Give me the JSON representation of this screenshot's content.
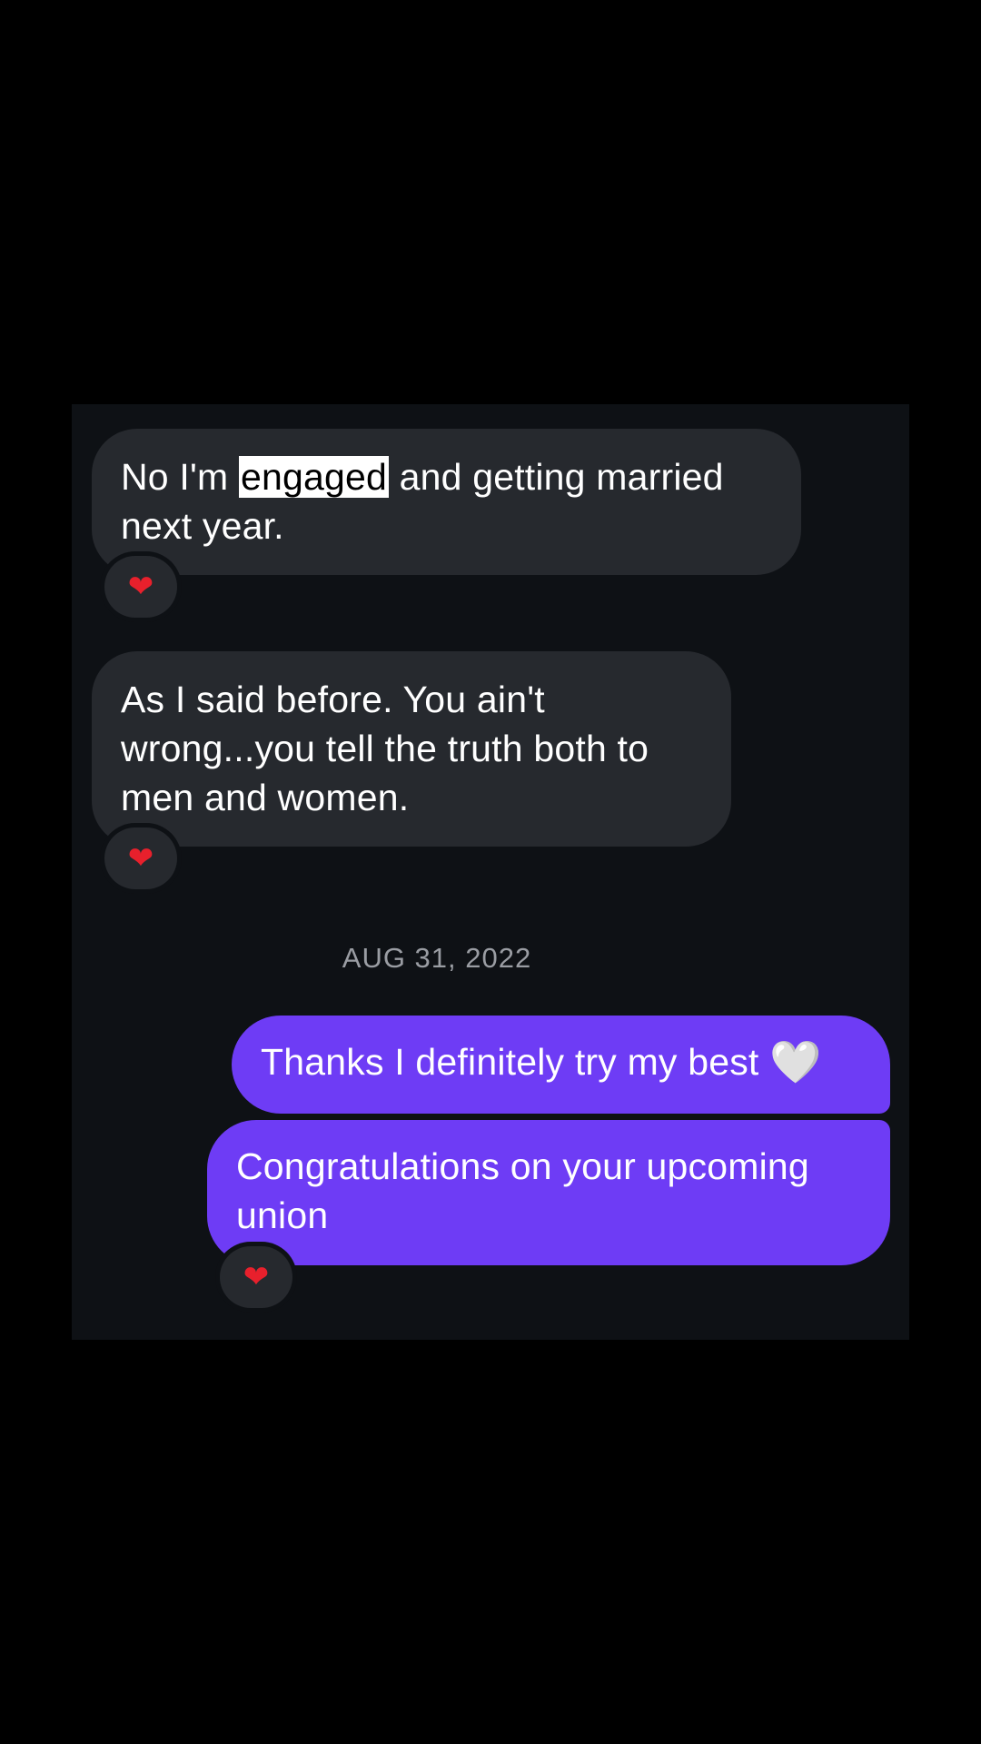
{
  "conversation": {
    "messages": [
      {
        "direction": "incoming",
        "text_before": "No I'm ",
        "highlighted": "engaged",
        "text_after": " and getting married next year.",
        "reaction": "❤"
      },
      {
        "direction": "incoming",
        "text": "As I said before. You ain't wrong...you tell the truth both to men and women.",
        "reaction": "❤"
      },
      {
        "direction": "outgoing",
        "text": "Thanks I definitely try my best",
        "emoji": "🤍"
      },
      {
        "direction": "outgoing",
        "text": "Congratulations on your upcoming union",
        "reaction": "❤"
      }
    ],
    "date_separator": "AUG 31, 2022"
  },
  "icons": {
    "reaction": "red-heart-icon",
    "inline_emoji": "white-heart-icon"
  },
  "colors": {
    "page_background": "#000000",
    "chat_background": "#0e1115",
    "incoming_bubble": "#26292e",
    "outgoing_bubble": "#6e3cf5",
    "reaction_heart": "#e8202c",
    "date_text": "#9a9da3"
  }
}
